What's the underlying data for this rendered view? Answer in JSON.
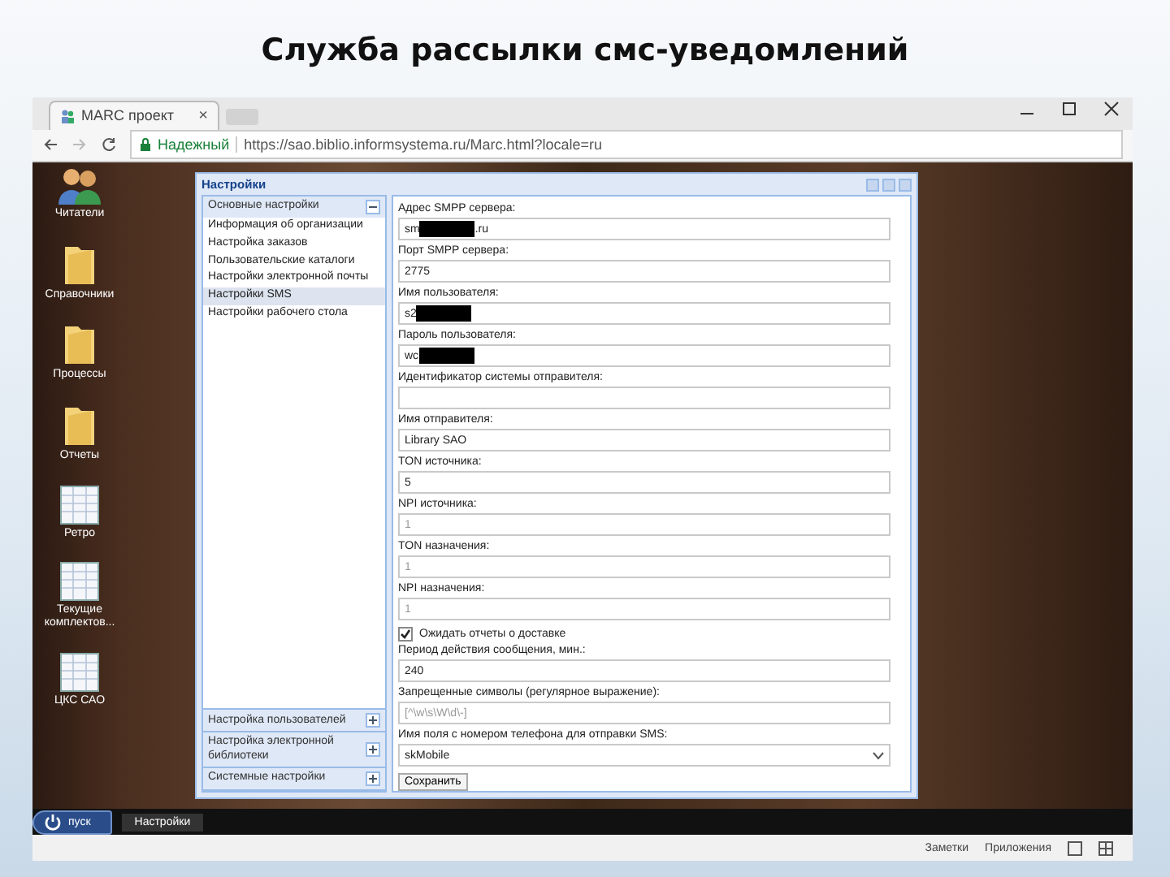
{
  "slide_title": "Служба рассылки смс-уведомлений",
  "browser": {
    "tab": {
      "title": "MARC проект",
      "close": "×"
    },
    "address": {
      "security": "Надежный",
      "url": "https://sao.biblio.informsystema.ru/Marc.html?locale=ru"
    }
  },
  "desktop_icons": [
    {
      "label": "Читатели",
      "kind": "people"
    },
    {
      "label": "Справочники",
      "kind": "folder"
    },
    {
      "label": "Процессы",
      "kind": "folder"
    },
    {
      "label": "Отчеты",
      "kind": "folder"
    },
    {
      "label": "Ретро",
      "kind": "sheet"
    },
    {
      "label": "Текущие комплектов...",
      "kind": "sheet"
    },
    {
      "label": "ЦКС САО",
      "kind": "sheet"
    }
  ],
  "settings_window": {
    "title": "Настройки",
    "sections": [
      {
        "label": "Основные настройки",
        "expanded": true,
        "items": [
          {
            "label": "Информация об организации",
            "selected": false
          },
          {
            "label": "Настройка заказов",
            "selected": false
          },
          {
            "label": "Пользовательские каталоги",
            "selected": false
          },
          {
            "label": "Настройки электронной почты",
            "selected": false
          },
          {
            "label": "Настройки SMS",
            "selected": true
          },
          {
            "label": "Настройки рабочего стола",
            "selected": false
          }
        ]
      },
      {
        "label": "Настройка пользователей",
        "expanded": false
      },
      {
        "label": "Настройка электронной библиотеки",
        "expanded": false
      },
      {
        "label": "Системные настройки",
        "expanded": false
      }
    ],
    "form": [
      {
        "kind": "text",
        "label": "Адрес SMPP сервера:",
        "value": "sm",
        "redacted": true,
        "value_after": ".ru"
      },
      {
        "kind": "text",
        "label": "Порт SMPP сервера:",
        "value": "2775",
        "redacted": false
      },
      {
        "kind": "text",
        "label": "Имя пользователя:",
        "value": "s2",
        "redacted": true
      },
      {
        "kind": "text",
        "label": "Пароль пользователя:",
        "value": "wc",
        "redacted": true
      },
      {
        "kind": "text",
        "label": "Идентификатор системы отправителя:",
        "redacted": false
      },
      {
        "kind": "text",
        "label": "Имя отправителя:",
        "value": "Library SAO",
        "redacted": false
      },
      {
        "kind": "text",
        "label": "TON источника:",
        "value": "5",
        "redacted": false
      },
      {
        "kind": "text",
        "label": "NPI источника:",
        "placeholder": "1",
        "redacted": false
      },
      {
        "kind": "text",
        "label": "TON назначения:",
        "placeholder": "1",
        "redacted": false
      },
      {
        "kind": "text",
        "label": "NPI назначения:",
        "placeholder": "1",
        "redacted": false
      },
      {
        "kind": "checkbox",
        "label": "Ожидать отчеты о доставке",
        "checked": true
      },
      {
        "kind": "text",
        "label": "Период действия сообщения, мин.:",
        "value": "240",
        "redacted": false
      },
      {
        "kind": "text",
        "label": "Запрещенные символы (регулярное выражение):",
        "placeholder": "[^\\w\\s\\W\\d\\-]",
        "redacted": false
      },
      {
        "kind": "select",
        "label": "Имя поля с номером телефона для отправки SMS:",
        "value": "skMobile"
      }
    ],
    "save_button": "Сохранить"
  },
  "taskbar": {
    "start": "пуск",
    "tasks": [
      "Настройки"
    ]
  },
  "status_bar": {
    "items": [
      "Заметки",
      "Приложения"
    ]
  }
}
